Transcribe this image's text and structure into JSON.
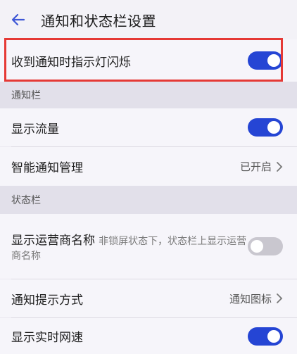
{
  "header": {
    "title": "通知和状态栏设置"
  },
  "rows": {
    "blink_light": {
      "label": "收到通知时指示灯闪烁",
      "state": "on"
    },
    "show_traffic": {
      "label": "显示流量",
      "state": "on"
    },
    "smart_notify": {
      "label": "智能通知管理",
      "value": "已开启"
    },
    "carrier_name": {
      "label": "显示运营商名称",
      "sub": "非锁屏状态下，状态栏上显示运营商名称",
      "state": "off"
    },
    "notify_mode": {
      "label": "通知提示方式",
      "value": "通知图标"
    },
    "net_speed": {
      "label": "显示实时网速",
      "state": "on"
    }
  },
  "sections": {
    "notification_bar": "通知栏",
    "status_bar": "状态栏"
  },
  "colors": {
    "toggle_on": "#2545d4",
    "toggle_off": "#c9c7cf",
    "highlight": "#e53935"
  },
  "icons": {
    "back": "arrow-left-icon",
    "chevron": "chevron-right-icon"
  }
}
